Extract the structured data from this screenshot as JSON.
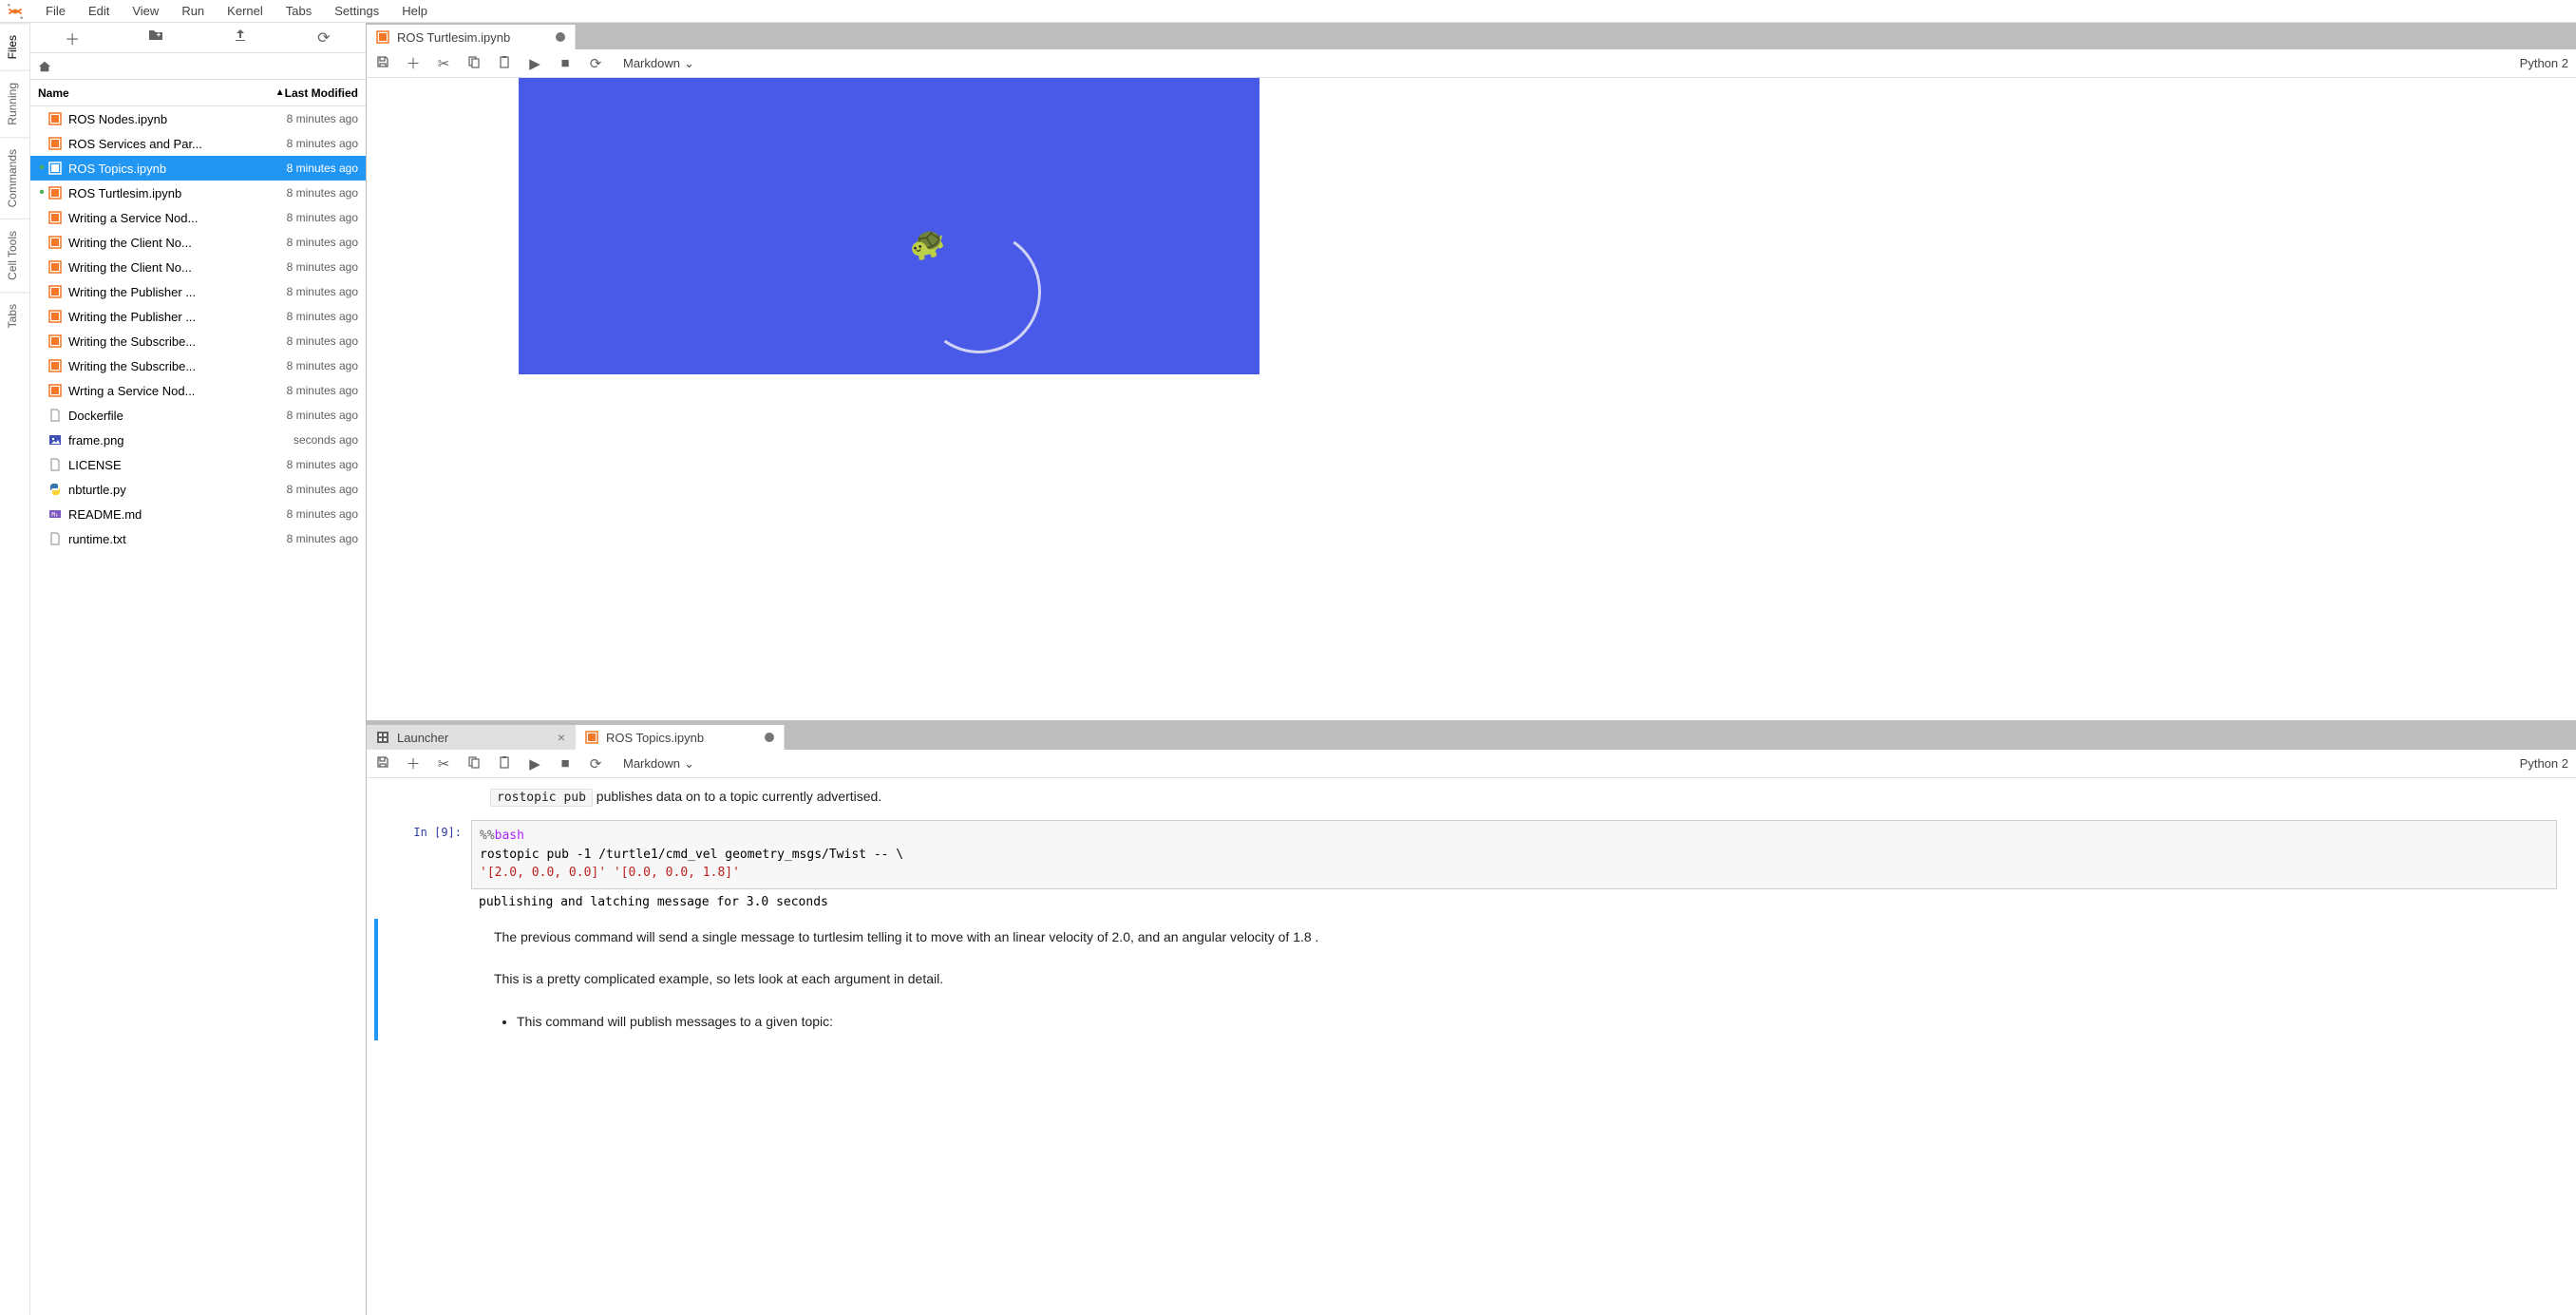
{
  "menu": {
    "items": [
      "File",
      "Edit",
      "View",
      "Run",
      "Kernel",
      "Tabs",
      "Settings",
      "Help"
    ]
  },
  "rail": {
    "tabs": [
      "Files",
      "Running",
      "Commands",
      "Cell Tools",
      "Tabs"
    ],
    "active": 0
  },
  "filebrowser": {
    "header_name": "Name",
    "header_modified": "Last Modified",
    "files": [
      {
        "name": "ROS Nodes.ipynb",
        "modified": "8 minutes ago",
        "type": "notebook",
        "running": false
      },
      {
        "name": "ROS Services and Par...",
        "modified": "8 minutes ago",
        "type": "notebook",
        "running": false
      },
      {
        "name": "ROS Topics.ipynb",
        "modified": "8 minutes ago",
        "type": "notebook",
        "running": true,
        "selected": true
      },
      {
        "name": "ROS Turtlesim.ipynb",
        "modified": "8 minutes ago",
        "type": "notebook",
        "running": true
      },
      {
        "name": "Writing a Service Nod...",
        "modified": "8 minutes ago",
        "type": "notebook",
        "running": false
      },
      {
        "name": "Writing the Client No...",
        "modified": "8 minutes ago",
        "type": "notebook",
        "running": false
      },
      {
        "name": "Writing the Client No...",
        "modified": "8 minutes ago",
        "type": "notebook",
        "running": false
      },
      {
        "name": "Writing the Publisher ...",
        "modified": "8 minutes ago",
        "type": "notebook",
        "running": false
      },
      {
        "name": "Writing the Publisher ...",
        "modified": "8 minutes ago",
        "type": "notebook",
        "running": false
      },
      {
        "name": "Writing the Subscribe...",
        "modified": "8 minutes ago",
        "type": "notebook",
        "running": false
      },
      {
        "name": "Writing the Subscribe...",
        "modified": "8 minutes ago",
        "type": "notebook",
        "running": false
      },
      {
        "name": "Wrting a Service Nod...",
        "modified": "8 minutes ago",
        "type": "notebook",
        "running": false
      },
      {
        "name": "Dockerfile",
        "modified": "8 minutes ago",
        "type": "file",
        "running": false
      },
      {
        "name": "frame.png",
        "modified": "seconds ago",
        "type": "image",
        "running": false
      },
      {
        "name": "LICENSE",
        "modified": "8 minutes ago",
        "type": "file",
        "running": false
      },
      {
        "name": "nbturtle.py",
        "modified": "8 minutes ago",
        "type": "python",
        "running": false
      },
      {
        "name": "README.md",
        "modified": "8 minutes ago",
        "type": "markdown",
        "running": false
      },
      {
        "name": "runtime.txt",
        "modified": "8 minutes ago",
        "type": "file",
        "running": false
      }
    ]
  },
  "top_pane": {
    "tab_label": "ROS Turtlesim.ipynb",
    "dirty": true,
    "celltype": "Markdown",
    "kernel": "Python 2"
  },
  "bottom_pane": {
    "tabs": [
      {
        "label": "Launcher",
        "icon": "launcher",
        "closable": true
      },
      {
        "label": "ROS Topics.ipynb",
        "icon": "notebook",
        "dirty": true,
        "active": true
      }
    ],
    "celltype": "Markdown",
    "kernel": "Python 2",
    "md1_code": "rostopic pub",
    "md1_text": " publishes data on to a topic currently advertised.",
    "prompt": "In [9]:",
    "code_line1a": "%%",
    "code_line1b": "bash",
    "code_line2": "rostopic pub -1 /turtle1/cmd_vel geometry_msgs/Twist -- \\",
    "code_line3": "'[2.0, 0.0, 0.0]' '[0.0, 0.0, 1.8]'",
    "output": "publishing and latching message for 3.0 seconds",
    "md2": "The previous command will send a single message to turtlesim telling it to move with an linear velocity of 2.0, and an angular velocity of 1.8 .",
    "md3": "This is a pretty complicated example, so lets look at each argument in detail.",
    "bullet1": "This command will publish messages to a given topic:"
  }
}
